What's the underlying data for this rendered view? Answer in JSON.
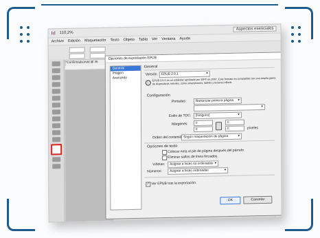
{
  "frame": {
    "accent": "#1e5a8c"
  },
  "app": {
    "logo": "Id",
    "zoom": "110,2%",
    "workspace": "Aspectos esenciales",
    "menu": [
      "Archivo",
      "Edición",
      "Maquetación",
      "Texto",
      "Objeto",
      "Tabla",
      "Ver",
      "Ventana",
      "Ayuda"
    ],
    "doc_tab": "*Confirmada.indd @ 36"
  },
  "dialog": {
    "title": "Opciones de exportación EPUB",
    "list": [
      "General",
      "Imagen",
      "Avanzado"
    ],
    "selected_index": 0,
    "section_general": "General",
    "version_label": "Versión:",
    "version_value": "EPUB 2.0.1",
    "version_info": "EPUB 2.0.1 es un estándar aprobado por IDPF en 2007. Este formato es compatible con una amplia gama de dispositivos móviles, como smartphones, tablets y lectores eBook.",
    "section_cover": "Configuración",
    "cover_label": "Portadas:",
    "cover_value": "Rasterizar primera página",
    "toc_label": "Estilo de TOC:",
    "toc_value": "[Ninguno]",
    "margins_label": "Márgenes:",
    "margin_top": "0",
    "margin_bottom": "0",
    "margin_left": "0",
    "margin_right": "0",
    "margins_unit": "píxeles",
    "order_label": "Orden del contenido:",
    "order_value": "Según maquetación de página",
    "section_text": "Opciones de texto",
    "footnote_label": "Colocar nota al pie de página después del párrafo",
    "soft_return_label": "Eliminar saltos de línea forzados",
    "bullets_label": "Viñetas:",
    "bullets_value": "Asignar a listas no ordenadas",
    "numbers_label": "Números:",
    "numbers_value": "Asignar a listas ordenadas",
    "view_after_label": "Ver EPUB tras la exportación",
    "ok": "OK",
    "cancel": "Cancelar"
  }
}
